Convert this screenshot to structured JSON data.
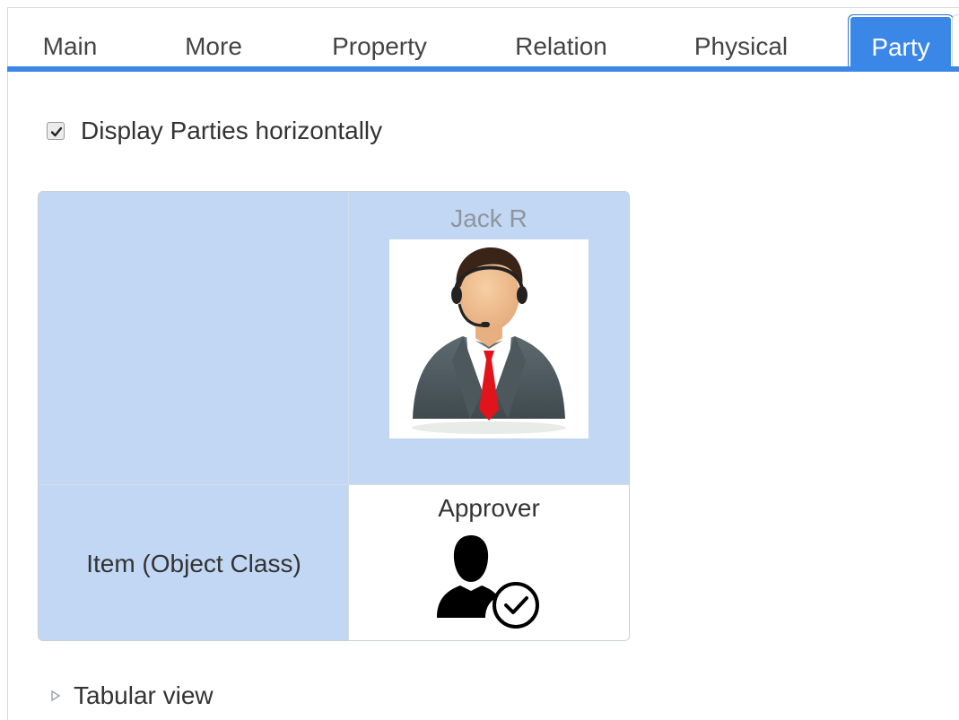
{
  "tabs": [
    {
      "label": "Main",
      "active": false
    },
    {
      "label": "More",
      "active": false
    },
    {
      "label": "Property",
      "active": false
    },
    {
      "label": "Relation",
      "active": false
    },
    {
      "label": "Physical",
      "active": false
    },
    {
      "label": "Party",
      "active": true
    }
  ],
  "display_option": {
    "label": "Display Parties horizontally",
    "checked": true
  },
  "party_grid": {
    "party_name": "Jack R",
    "party_photo_icon": "businessman-headset-icon",
    "row_label": "Item (Object Class)",
    "role_label": "Approver",
    "role_icon": "user-check-icon"
  },
  "tabular_view": {
    "label": "Tabular view",
    "icon": "triangle-right-icon"
  },
  "colors": {
    "accent": "#3b87e8",
    "cell_highlight": "#c2d7f3",
    "muted_text": "#8e959e"
  }
}
